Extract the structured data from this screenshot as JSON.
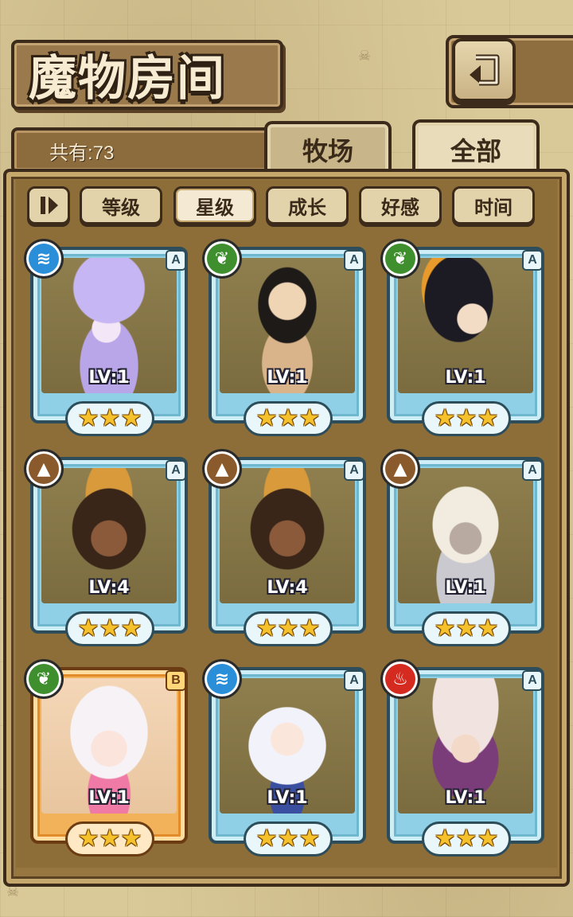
{
  "header": {
    "title": "魔物房间",
    "back_icon": "return-arrow-icon"
  },
  "counter": {
    "label": "共有:73"
  },
  "tabs": [
    {
      "label": "牧场",
      "active": false
    },
    {
      "label": "全部",
      "active": true
    }
  ],
  "filters": {
    "sort_icon": "sort-toggle-icon",
    "buttons": [
      {
        "label": "等级",
        "active": false
      },
      {
        "label": "星级",
        "active": true
      },
      {
        "label": "成长",
        "active": false
      },
      {
        "label": "好感",
        "active": false
      },
      {
        "label": "时间",
        "active": false
      }
    ]
  },
  "cards": [
    {
      "level": "LV:1",
      "rank": "A",
      "element": "water",
      "stars": 3,
      "frame": "blue",
      "portrait": "jellyfish-girl"
    },
    {
      "level": "LV:1",
      "rank": "A",
      "element": "leaf",
      "stars": 3,
      "frame": "blue",
      "portrait": "black-hair-girl"
    },
    {
      "level": "LV:1",
      "rank": "A",
      "element": "leaf",
      "stars": 3,
      "frame": "blue",
      "portrait": "witch-girl"
    },
    {
      "level": "LV:4",
      "rank": "A",
      "element": "earth",
      "stars": 3,
      "frame": "blue",
      "portrait": "dark-skin-girl"
    },
    {
      "level": "LV:4",
      "rank": "A",
      "element": "earth",
      "stars": 3,
      "frame": "blue",
      "portrait": "dark-skin-girl"
    },
    {
      "level": "LV:1",
      "rank": "A",
      "element": "earth",
      "stars": 3,
      "frame": "blue",
      "portrait": "sheep-knight-girl"
    },
    {
      "level": "LV:1",
      "rank": "B",
      "element": "leaf",
      "stars": 3,
      "frame": "orange",
      "portrait": "white-hair-girl"
    },
    {
      "level": "LV:1",
      "rank": "A",
      "element": "water",
      "stars": 3,
      "frame": "blue",
      "portrait": "bunny-girl"
    },
    {
      "level": "LV:1",
      "rank": "A",
      "element": "fire",
      "stars": 3,
      "frame": "blue",
      "portrait": "mushroom-girl"
    }
  ],
  "colors": {
    "water": "#2a8fd8",
    "leaf": "#3f8f2f",
    "earth": "#8a5a2c",
    "fire": "#d42a1f"
  }
}
